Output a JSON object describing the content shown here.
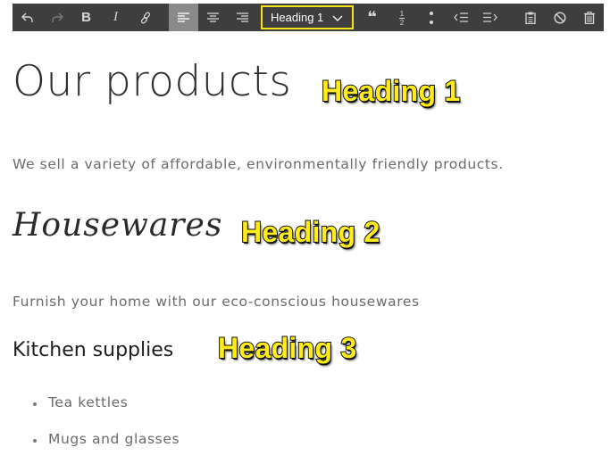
{
  "toolbar": {
    "buttons": [
      {
        "name": "undo-button",
        "icon": "undo-icon",
        "state": "normal"
      },
      {
        "name": "redo-button",
        "icon": "redo-icon",
        "state": "disabled"
      },
      {
        "name": "bold-button",
        "icon": "bold-icon",
        "glyph": "B"
      },
      {
        "name": "italic-button",
        "icon": "italic-icon",
        "glyph": "I"
      },
      {
        "name": "link-button",
        "icon": "link-icon"
      },
      {
        "name": "align-left-button",
        "icon": "align-left-icon",
        "state": "active"
      },
      {
        "name": "align-center-button",
        "icon": "align-center-icon"
      },
      {
        "name": "align-right-button",
        "icon": "align-right-icon"
      },
      {
        "name": "blockquote-button",
        "icon": "quote-icon",
        "glyph": "❝"
      },
      {
        "name": "ordered-list-button",
        "icon": "ordered-list-icon"
      },
      {
        "name": "unordered-list-button",
        "icon": "bullet-list-icon"
      },
      {
        "name": "outdent-button",
        "icon": "outdent-icon"
      },
      {
        "name": "indent-button",
        "icon": "indent-icon"
      },
      {
        "name": "paste-button",
        "icon": "clipboard-icon"
      },
      {
        "name": "clear-format-button",
        "icon": "ban-icon"
      },
      {
        "name": "delete-button",
        "icon": "trash-icon"
      }
    ],
    "heading_select": {
      "value": "Heading 1"
    }
  },
  "colors": {
    "toolbar_bg": "#3e3e3e",
    "toolbar_active": "#8a8a8a",
    "select_border": "#f2e31b",
    "callout_fill": "#ffec1a"
  },
  "content": {
    "h1": "Our products",
    "lead": "We sell a variety of affordable, environmentally friendly products.",
    "h2": "Housewares",
    "para": "Furnish your home with our eco-conscious housewares",
    "h3": "Kitchen supplies",
    "list": [
      "Tea kettles",
      "Mugs and glasses"
    ]
  },
  "callouts": {
    "h1": "Heading 1",
    "h2": "Heading 2",
    "h3": "Heading 3"
  }
}
